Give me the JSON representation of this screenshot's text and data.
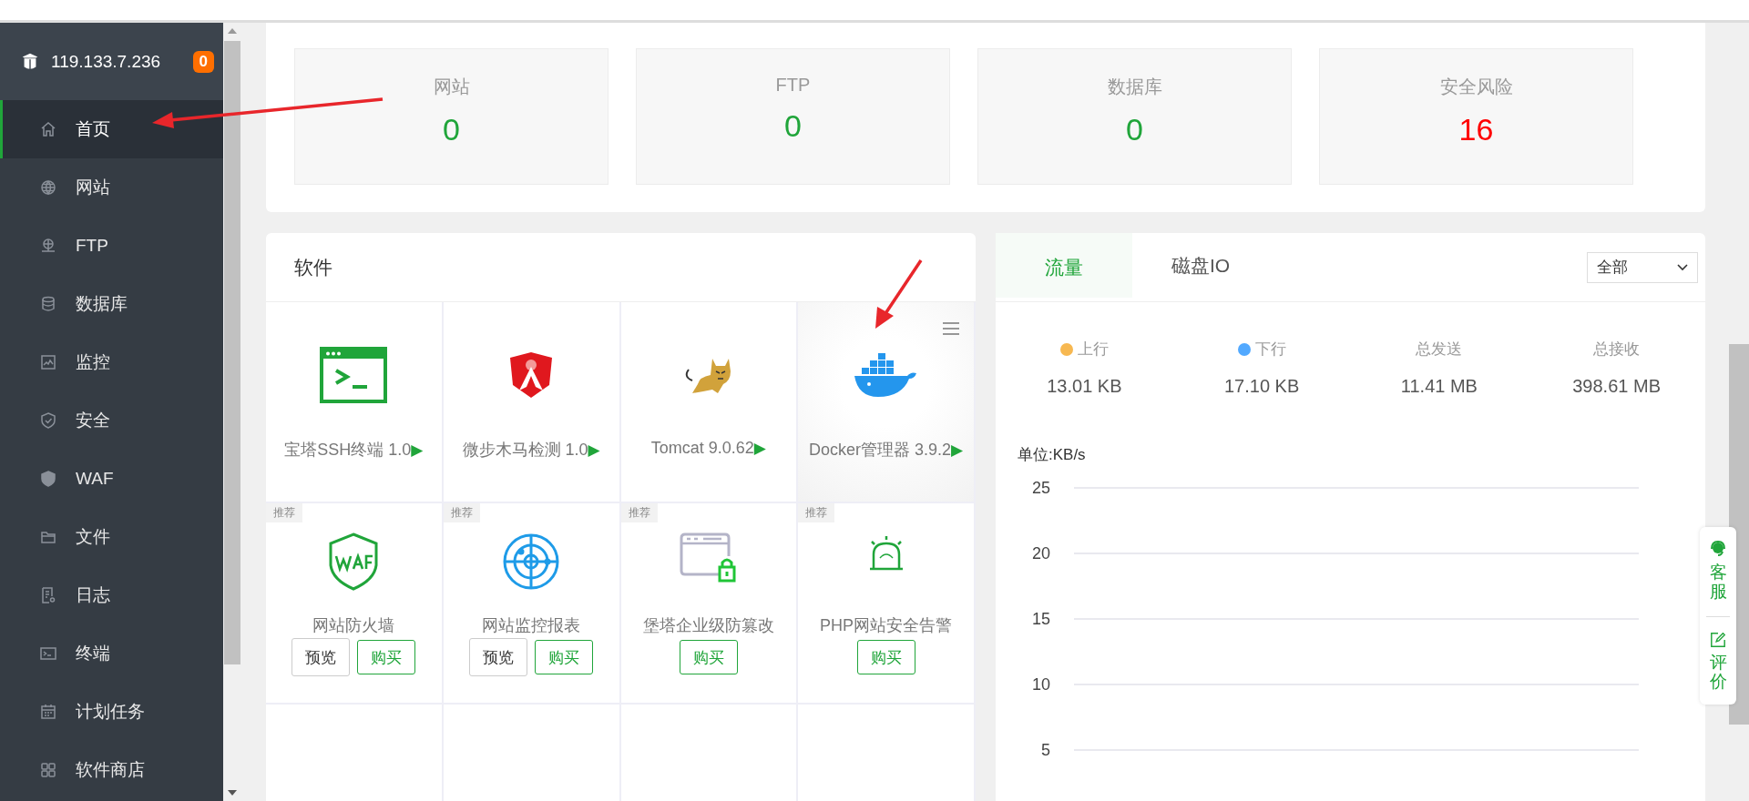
{
  "sidebar": {
    "server": "119.133.7.236",
    "badge": "0",
    "items": [
      {
        "label": "首页",
        "selected": true
      },
      {
        "label": "网站",
        "selected": false
      },
      {
        "label": "FTP",
        "selected": false
      },
      {
        "label": "数据库",
        "selected": false
      },
      {
        "label": "监控",
        "selected": false
      },
      {
        "label": "安全",
        "selected": false
      },
      {
        "label": "WAF",
        "selected": false
      },
      {
        "label": "文件",
        "selected": false
      },
      {
        "label": "日志",
        "selected": false
      },
      {
        "label": "终端",
        "selected": false
      },
      {
        "label": "计划任务",
        "selected": false
      },
      {
        "label": "软件商店",
        "selected": false
      }
    ]
  },
  "stats": [
    {
      "label": "网站",
      "value": "0",
      "warning": false
    },
    {
      "label": "FTP",
      "value": "0",
      "warning": false
    },
    {
      "label": "数据库",
      "value": "0",
      "warning": false
    },
    {
      "label": "安全风险",
      "value": "16",
      "warning": true
    }
  ],
  "software": {
    "title": "软件",
    "installed": [
      {
        "name": "宝塔SSH终端 1.0",
        "play": "▶",
        "highlighted": false
      },
      {
        "name": "微步木马检测 1.0",
        "play": "▶",
        "highlighted": false
      },
      {
        "name": "Tomcat 9.0.62",
        "play": "▶",
        "highlighted": false
      },
      {
        "name": "Docker管理器 3.9.2",
        "play": "▶",
        "highlighted": true
      }
    ],
    "recommended": [
      {
        "tag": "推荐",
        "name": "网站防火墙",
        "buttons": [
          {
            "label": "预览",
            "kind": "preview"
          },
          {
            "label": "购买",
            "kind": "buy"
          }
        ]
      },
      {
        "tag": "推荐",
        "name": "网站监控报表",
        "buttons": [
          {
            "label": "预览",
            "kind": "preview"
          },
          {
            "label": "购买",
            "kind": "buy"
          }
        ]
      },
      {
        "tag": "推荐",
        "name": "堡塔企业级防篡改",
        "buttons": [
          {
            "label": "购买",
            "kind": "buy"
          }
        ]
      },
      {
        "tag": "推荐",
        "name": "PHP网站安全告警",
        "buttons": [
          {
            "label": "购买",
            "kind": "buy"
          }
        ]
      }
    ]
  },
  "traffic": {
    "tabs": [
      {
        "label": "流量",
        "selected": true
      },
      {
        "label": "磁盘IO",
        "selected": false
      }
    ],
    "filter": "全部",
    "metrics": [
      {
        "label": "上行",
        "value": "13.01 KB",
        "color": "#f7b851"
      },
      {
        "label": "下行",
        "value": "17.10 KB",
        "color": "#52a9ff"
      },
      {
        "label": "总发送",
        "value": "11.41 MB"
      },
      {
        "label": "总接收",
        "value": "398.61 MB"
      }
    ],
    "chart_unit": "单位:KB/s",
    "chart_ticks": [
      "25",
      "20",
      "15",
      "10",
      "5"
    ]
  },
  "float_menu": [
    {
      "label": "客服"
    },
    {
      "label": "评价"
    }
  ]
}
